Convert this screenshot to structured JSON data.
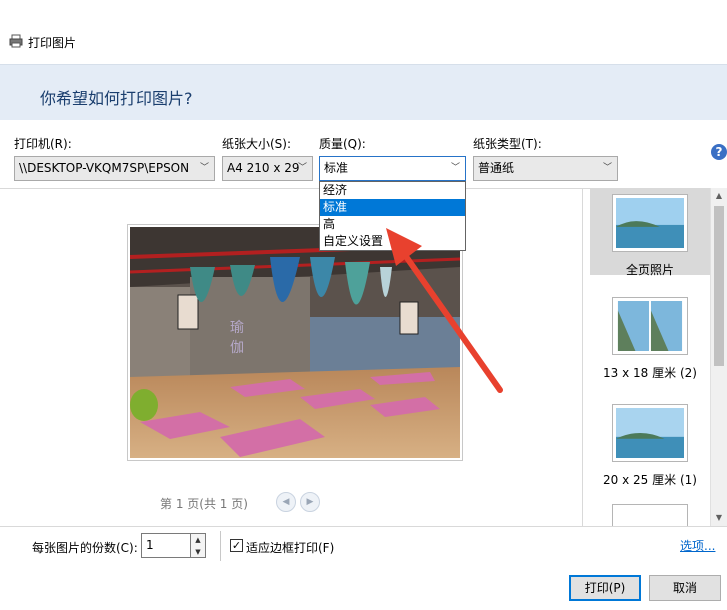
{
  "window": {
    "title": "打印图片"
  },
  "header": {
    "heading": "你希望如何打印图片?"
  },
  "controls": {
    "printer": {
      "label": "打印机(R):",
      "value": "\\\\DESKTOP-VKQM7SP\\EPSON"
    },
    "paper_size": {
      "label": "纸张大小(S):",
      "value": "A4 210 x 29"
    },
    "quality": {
      "label": "质量(Q):",
      "value": "标准"
    },
    "paper_type": {
      "label": "纸张类型(T):",
      "value": "普通纸"
    }
  },
  "quality_dropdown": {
    "options": [
      "经济",
      "标准",
      "高",
      "自定义设置"
    ],
    "highlighted": "标准"
  },
  "preview": {
    "pager_text": "第 1 页(共 1 页)"
  },
  "layouts": [
    {
      "label": "全页照片",
      "selected": true
    },
    {
      "label": "13 x 18 厘米 (2)",
      "selected": false
    },
    {
      "label": "20 x 25 厘米 (1)",
      "selected": false
    }
  ],
  "footer": {
    "copies_label": "每张图片的份数(C):",
    "copies_value": "1",
    "fit_label": "适应边框打印(F)",
    "fit_checked": true,
    "options_link": "选项...",
    "print_button": "打印(P)",
    "cancel_button": "取消"
  },
  "colors": {
    "accent": "#0078d7",
    "header_band": "#e4ecf6",
    "annotation_arrow": "#e8412e"
  }
}
